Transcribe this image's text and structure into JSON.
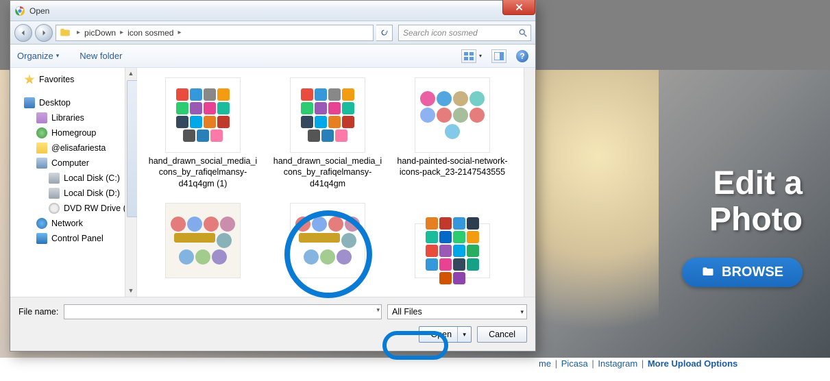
{
  "dialog": {
    "title": "Open",
    "breadcrumb": {
      "part1": "picDown",
      "part2": "icon sosmed"
    },
    "search_placeholder": "Search icon sosmed",
    "organize": "Organize",
    "new_folder": "New folder",
    "file_name_label": "File name:",
    "file_name_value": "",
    "filter": "All Files",
    "open_btn": "Open",
    "cancel_btn": "Cancel"
  },
  "sidebar": {
    "favorites": "Favorites",
    "desktop": "Desktop",
    "libraries": "Libraries",
    "homegroup": "Homegroup",
    "user": "@elisafariesta",
    "computer": "Computer",
    "localc": "Local Disk (C:)",
    "locald": "Local Disk (D:)",
    "dvd": "DVD RW Drive (",
    "network": "Network",
    "control": "Control Panel"
  },
  "files": [
    {
      "name": "hand_drawn_social_media_icons_by_rafiqelmansy-d41q4gm (1)"
    },
    {
      "name": "hand_drawn_social_media_icons_by_rafiqelmansy-d41q4gm"
    },
    {
      "name": "hand-painted-social-network-icons-pack_23-2147543555"
    },
    {
      "name": ""
    },
    {
      "name": ""
    },
    {
      "name": ""
    }
  ],
  "page": {
    "hero_line1": "Edit a",
    "hero_line2": "Photo",
    "browse": "BROWSE",
    "link_me": "me",
    "link_picasa": "Picasa",
    "link_instagram": "Instagram",
    "link_more": "More Upload Options"
  }
}
